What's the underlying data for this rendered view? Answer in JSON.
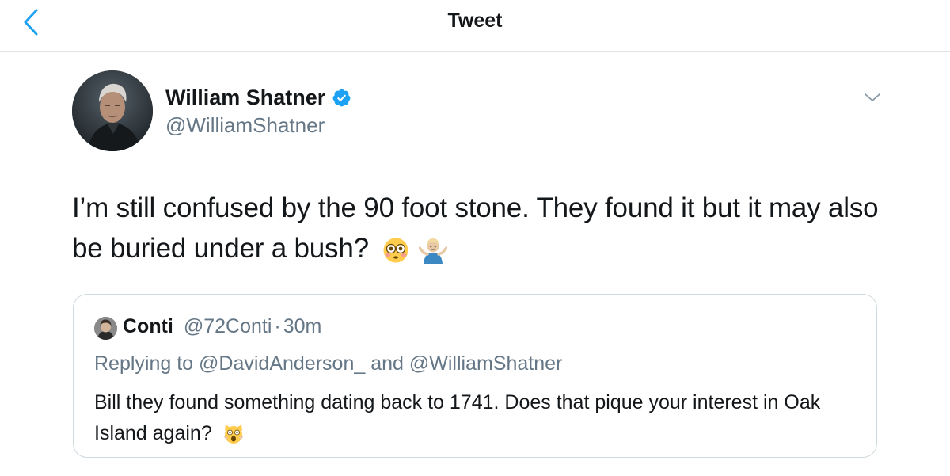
{
  "header": {
    "title": "Tweet",
    "back_icon": "chevron-left-icon",
    "accent_color": "#1da1f2"
  },
  "tweet": {
    "author_name": "William Shatner",
    "author_handle": "@WilliamShatner",
    "verified": true,
    "text": "I’m still confused by the 90 foot stone. They found it but it may also be buried under a bush?",
    "emojis": [
      "flushed-face-emoji",
      "person-shrugging-emoji"
    ],
    "more_icon": "chevron-down-icon"
  },
  "quote": {
    "author_name": "Conti",
    "author_handle": "@72Conti",
    "separator": "·",
    "time": "30m",
    "replying_prefix": "Replying to ",
    "reply_mention_1": "@DavidAnderson_",
    "reply_joiner": " and ",
    "reply_mention_2": "@WilliamShatner",
    "text": "Bill they found something dating back to 1741. Does that pique your interest in Oak Island again?",
    "emojis": [
      "screaming-cat-emoji"
    ]
  }
}
